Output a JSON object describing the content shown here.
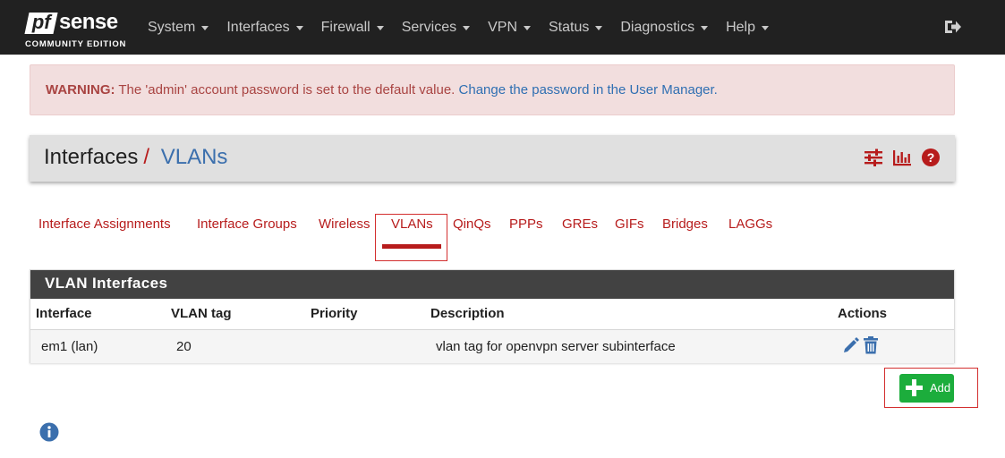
{
  "brand": {
    "logo_pf": "pf",
    "logo_sense": "sense",
    "edition": "COMMUNITY EDITION"
  },
  "nav": {
    "items": [
      {
        "label": "System"
      },
      {
        "label": "Interfaces"
      },
      {
        "label": "Firewall"
      },
      {
        "label": "Services"
      },
      {
        "label": "VPN"
      },
      {
        "label": "Status"
      },
      {
        "label": "Diagnostics"
      },
      {
        "label": "Help"
      }
    ],
    "logout_icon": "sign-out-icon"
  },
  "alert": {
    "strong": "WARNING:",
    "text": " The 'admin' account password is set to the default value. ",
    "link": "Change the password in the User Manager."
  },
  "header": {
    "crumb": "Interfaces",
    "separator": "/",
    "current": "VLANs",
    "icons": [
      "sliders-icon",
      "bar-chart-icon",
      "help-icon"
    ]
  },
  "tabs": [
    {
      "label": "Interface Assignments",
      "active": false
    },
    {
      "label": "Interface Groups",
      "active": false
    },
    {
      "label": "Wireless",
      "active": false
    },
    {
      "label": "VLANs",
      "active": true
    },
    {
      "label": "QinQs",
      "active": false
    },
    {
      "label": "PPPs",
      "active": false
    },
    {
      "label": "GREs",
      "active": false
    },
    {
      "label": "GIFs",
      "active": false
    },
    {
      "label": "Bridges",
      "active": false
    },
    {
      "label": "LAGGs",
      "active": false
    }
  ],
  "panel": {
    "title": "VLAN Interfaces",
    "columns": [
      "Interface",
      "VLAN tag",
      "Priority",
      "Description",
      "Actions"
    ],
    "rows": [
      {
        "interface": "em1 (lan)",
        "vlan_tag": "20",
        "priority": "",
        "description": "vlan tag for openvpn server subinterface",
        "actions": [
          "edit-icon",
          "trash-icon"
        ]
      }
    ]
  },
  "add_button": {
    "label": "Add"
  },
  "colors": {
    "navbar": "#212121",
    "accent_red": "#b71c1c",
    "link_blue": "#3b6fad",
    "add_green": "#1cad3c",
    "panel_heading": "#424242"
  }
}
